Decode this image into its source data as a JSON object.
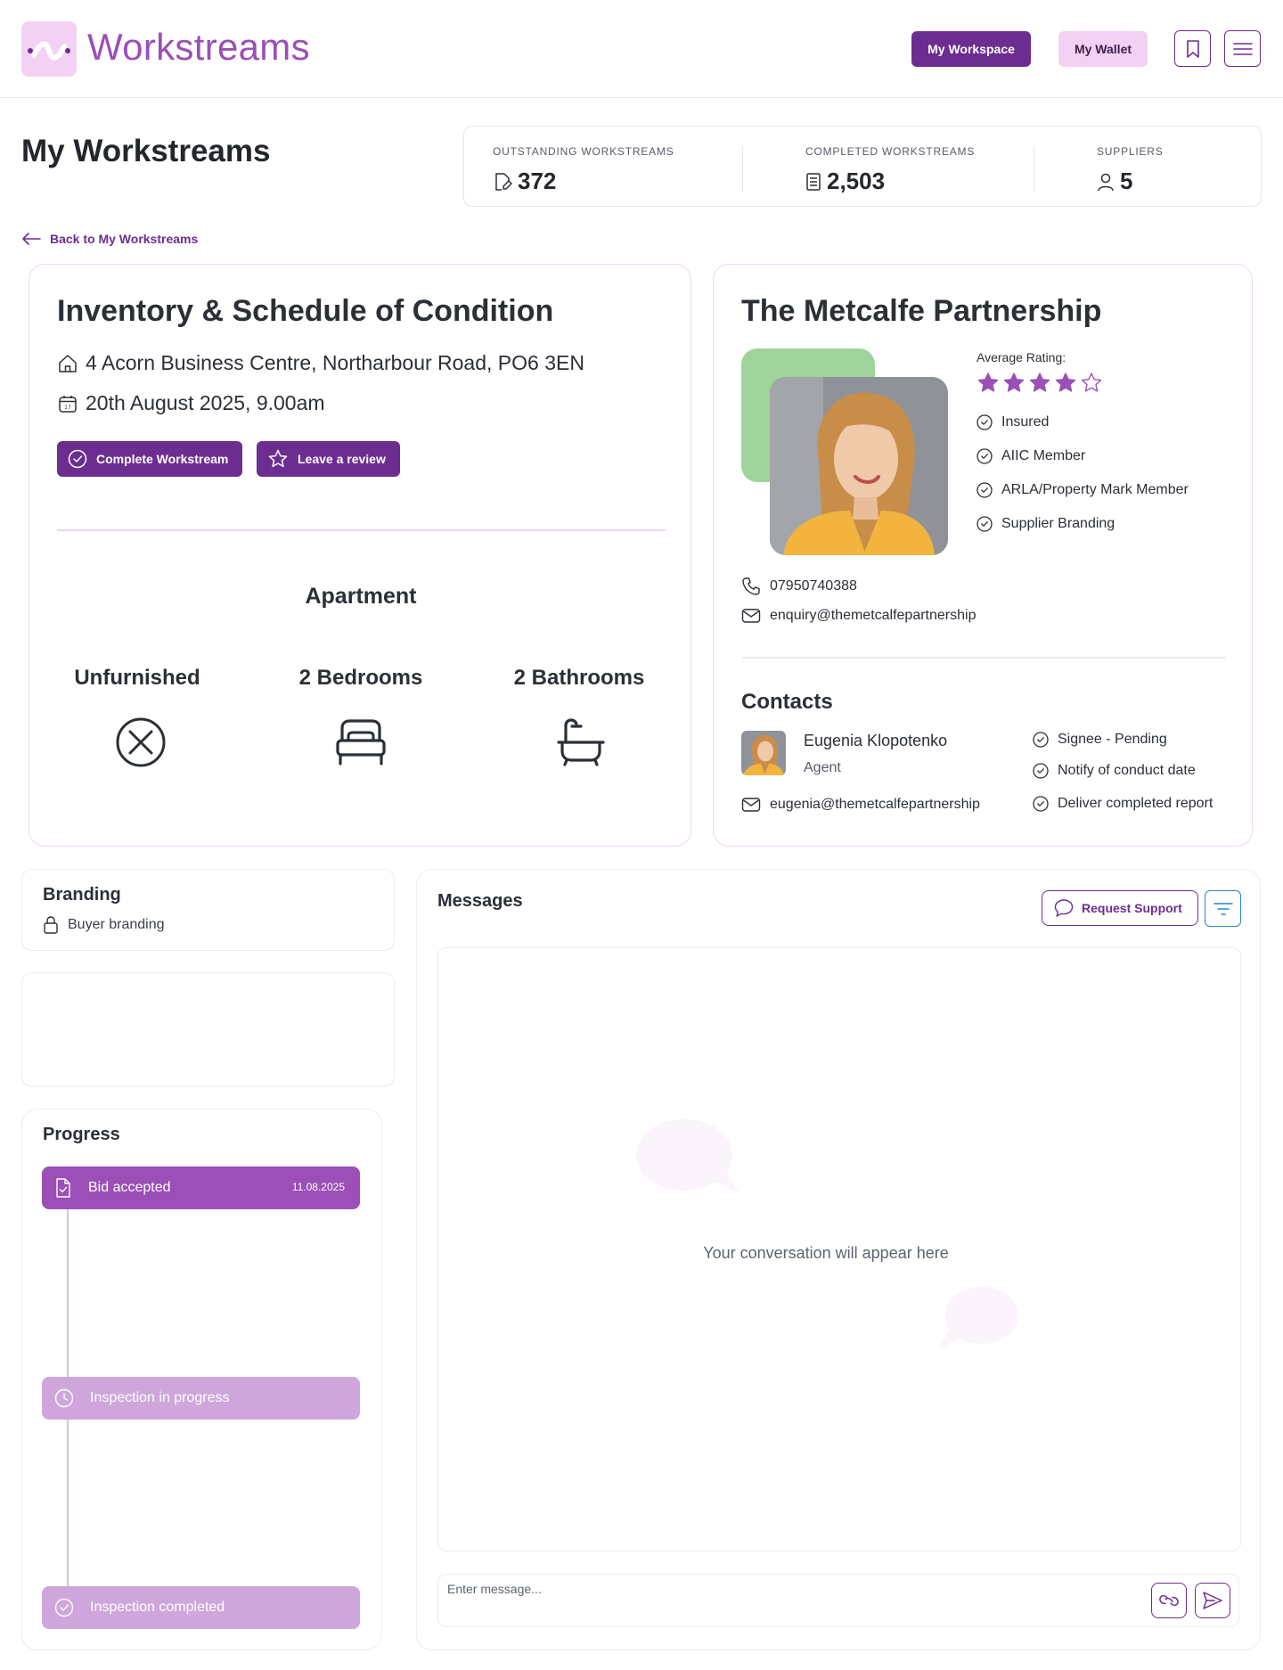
{
  "header": {
    "logo_text": "Workstreams",
    "workspace_label": "My Workspace",
    "wallet_label": "My Wallet"
  },
  "page_title": "My Workstreams",
  "stats": [
    {
      "label": "OUTSTANDING WORKSTREAMS",
      "value": "372",
      "icon": "pencil-document-icon"
    },
    {
      "label": "COMPLETED WORKSTREAMS",
      "value": "2,503",
      "icon": "document-list-icon"
    },
    {
      "label": "SUPPLIERS",
      "value": "5",
      "icon": "user-icon"
    }
  ],
  "back_link": "Back to My Workstreams",
  "workstream": {
    "title": "Inventory & Schedule of Condition",
    "address": "4 Acorn Business Centre, Northarbour Road, PO6 3EN",
    "date": "20th August 2025, 9.00am",
    "complete_label": "Complete Workstream",
    "review_label": "Leave a review",
    "property_type": "Apartment",
    "features": [
      {
        "label": "Unfurnished",
        "icon": "x-circle-icon"
      },
      {
        "label": "2 Bedrooms",
        "icon": "bed-icon"
      },
      {
        "label": "2 Bathrooms",
        "icon": "bath-icon"
      }
    ]
  },
  "supplier": {
    "name": "The Metcalfe Partnership",
    "rating_label": "Average Rating:",
    "rating": 4,
    "rating_max": 5,
    "accreditations": [
      "Insured",
      "AIIC Member",
      "ARLA/Property Mark Member",
      "Supplier Branding"
    ],
    "phone": "07950740388",
    "email": "enquiry@themetcalfepartnership",
    "contacts_title": "Contacts",
    "contact": {
      "name": "Eugenia Klopotenko",
      "role": "Agent",
      "email": "eugenia@themetcalfepartnership",
      "flags": [
        "Signee - Pending",
        "Notify of conduct date",
        "Deliver completed report"
      ]
    }
  },
  "branding": {
    "title": "Branding",
    "value": "Buyer branding"
  },
  "progress": {
    "title": "Progress",
    "steps": [
      {
        "label": "Bid accepted",
        "date": "11.08.2025",
        "state": "done",
        "icon": "document-check-icon"
      },
      {
        "label": "Inspection in progress",
        "date": "",
        "state": "pending",
        "icon": "clock-icon"
      },
      {
        "label": "Inspection completed",
        "date": "",
        "state": "pending",
        "icon": "check-circle-icon"
      }
    ]
  },
  "messages": {
    "title": "Messages",
    "support_label": "Request Support",
    "empty_text": "Your conversation will appear here",
    "input_placeholder": "Enter message..."
  },
  "colors": {
    "brand": "#6c2d91",
    "brand_light": "#f3d1f3",
    "progress_done": "#9b4fb7",
    "progress_pending": "#cfa6dc",
    "photo_bg": "#9fd39a"
  }
}
